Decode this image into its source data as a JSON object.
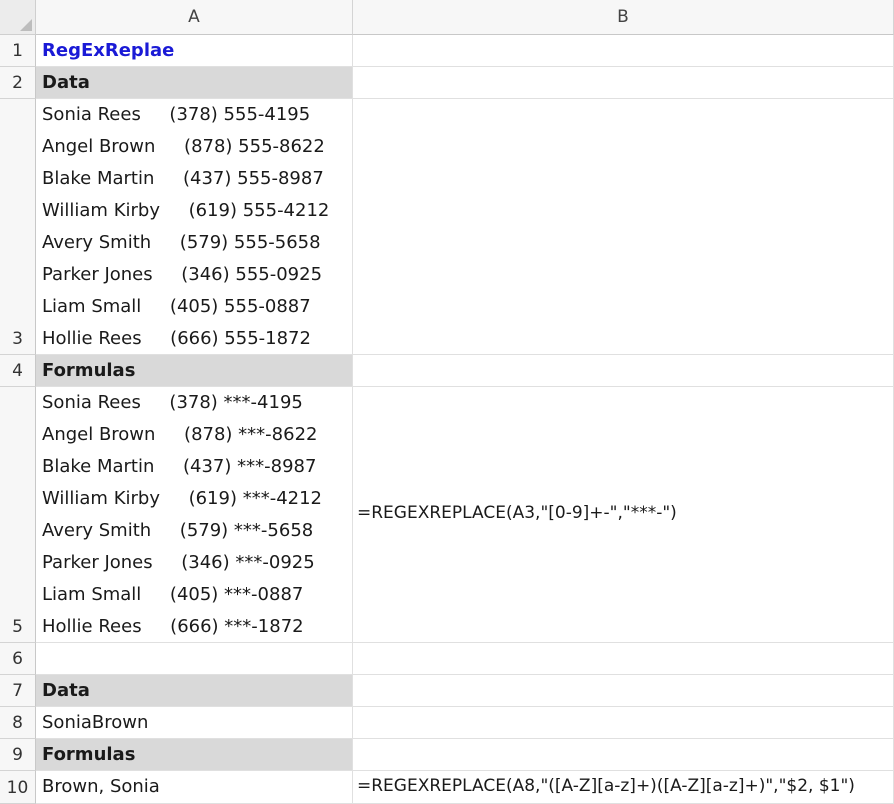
{
  "columns": [
    "A",
    "B"
  ],
  "rows": [
    "1",
    "2",
    "3",
    "4",
    "5",
    "6",
    "7",
    "8",
    "9",
    "10"
  ],
  "cells": {
    "A1": "RegExReplae",
    "A2": "Data",
    "A3_lines": [
      "Sonia Rees     (378) 555-4195",
      "Angel Brown     (878) 555-8622",
      "Blake Martin     (437) 555-8987",
      "William Kirby     (619) 555-4212",
      "Avery Smith     (579) 555-5658",
      "Parker Jones     (346) 555-0925",
      "Liam Small     (405) 555-0887",
      "Hollie Rees     (666) 555-1872"
    ],
    "A4": "Formulas",
    "A5_lines": [
      "Sonia Rees     (378) ***-4195",
      "Angel Brown     (878) ***-8622",
      "Blake Martin     (437) ***-8987",
      "William Kirby     (619) ***-4212",
      "Avery Smith     (579) ***-5658",
      "Parker Jones     (346) ***-0925",
      "Liam Small     (405) ***-0887",
      "Hollie Rees     (666) ***-1872"
    ],
    "B5": "=REGEXREPLACE(A3,\"[0-9]+-\",\"***-\")",
    "A7": "Data",
    "A8": "SoniaBrown",
    "A9": "Formulas",
    "A10": "Brown, Sonia",
    "B10": "=REGEXREPLACE(A8,\"([A-Z][a-z]+)([A-Z][a-z]+)\",\"$2, $1\")"
  },
  "colors": {
    "title_text": "#1a1ad6",
    "header_fill": "#d9d9d9"
  }
}
